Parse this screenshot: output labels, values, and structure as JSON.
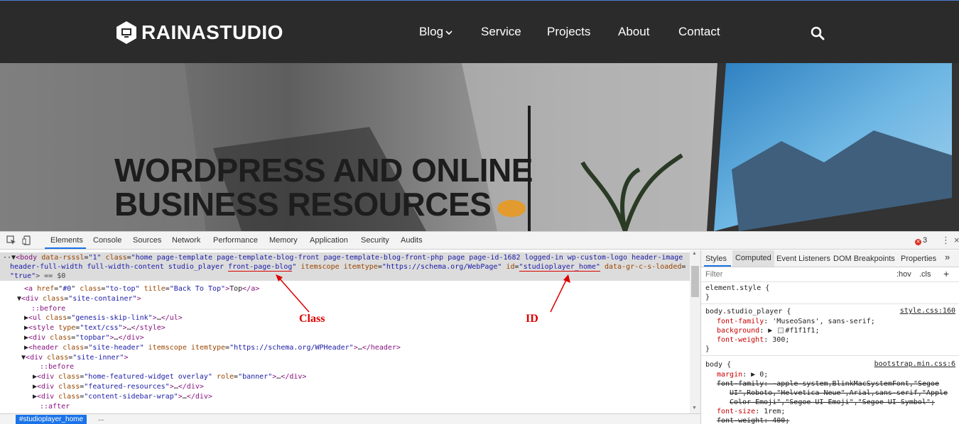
{
  "site": {
    "logo_text": "RAINASTUDIO",
    "nav": [
      "Blog",
      "Service",
      "Projects",
      "About",
      "Contact"
    ],
    "hero_line1": "WORDPRESS AND ONLINE",
    "hero_line2": "BUSINESS RESOURCES"
  },
  "devtools": {
    "tabs": [
      "Elements",
      "Console",
      "Sources",
      "Network",
      "Performance",
      "Memory",
      "Application",
      "Security",
      "Audits"
    ],
    "error_count": "3",
    "dom": {
      "l1a": "<body ",
      "l1_attr1": "data-rsssl",
      "l1_val1": "\"1\"",
      "l1_attr2": "class",
      "l1_val2a": "\"home page-template page-template-blog-front page-template-blog-front-php page page-id-1682 logged-in wp-custom-logo header-image",
      "l2_val2b": "header-full-width full-width-content studio_player ",
      "l2_val2c": "front-page-blog",
      "l2_val2d": "\"",
      "l2_attr3": "itemscope",
      "l2_attr4": "itemtype",
      "l2_val4": "\"https://schema.org/WebPage\"",
      "l2_attr5": "id",
      "l2_val5a": "\"",
      "l2_val5b": "studioplayer_home",
      "l2_val5c": "\"",
      "l2_attr6": "data-gr-c-s-loaded",
      "l3_val6": "\"true\"",
      "l3_tail": "> == $0",
      "rows": [
        {
          "indent": 34,
          "parts": [
            [
              "tag",
              "<a "
            ],
            [
              "attr",
              "href"
            ],
            [
              "plain",
              "=\""
            ],
            [
              "val",
              "#0"
            ],
            [
              "plain",
              "\" "
            ],
            [
              "attr",
              "class"
            ],
            [
              "plain",
              "="
            ],
            [
              "val",
              "\"to-top\""
            ],
            [
              "plain",
              " "
            ],
            [
              "attr",
              "title"
            ],
            [
              "plain",
              "="
            ],
            [
              "val",
              "\"Back To Top\""
            ],
            [
              "tag",
              ">"
            ],
            [
              "plain",
              "Top"
            ],
            [
              "tag",
              "</a>"
            ]
          ]
        },
        {
          "indent": 24,
          "parts": [
            [
              "plain",
              "▼"
            ],
            [
              "tag",
              "<div "
            ],
            [
              "attr",
              "class"
            ],
            [
              "plain",
              "="
            ],
            [
              "val",
              "\"site-container\""
            ],
            [
              "tag",
              ">"
            ]
          ]
        },
        {
          "indent": 44,
          "parts": [
            [
              "pseudo",
              "::before"
            ]
          ]
        },
        {
          "indent": 34,
          "parts": [
            [
              "plain",
              "▶"
            ],
            [
              "tag",
              "<ul "
            ],
            [
              "attr",
              "class"
            ],
            [
              "plain",
              "="
            ],
            [
              "val",
              "\"genesis-skip-link\""
            ],
            [
              "tag",
              ">"
            ],
            [
              "plain",
              "…"
            ],
            [
              "tag",
              "</ul>"
            ]
          ]
        },
        {
          "indent": 34,
          "parts": [
            [
              "plain",
              "▶"
            ],
            [
              "tag",
              "<style "
            ],
            [
              "attr",
              "type"
            ],
            [
              "plain",
              "="
            ],
            [
              "val",
              "\"text/css\""
            ],
            [
              "tag",
              ">"
            ],
            [
              "plain",
              "…"
            ],
            [
              "tag",
              "</style>"
            ]
          ]
        },
        {
          "indent": 34,
          "parts": [
            [
              "plain",
              "▶"
            ],
            [
              "tag",
              "<div "
            ],
            [
              "attr",
              "class"
            ],
            [
              "plain",
              "="
            ],
            [
              "val",
              "\"topbar\""
            ],
            [
              "tag",
              ">"
            ],
            [
              "plain",
              "…"
            ],
            [
              "tag",
              "</div>"
            ]
          ]
        },
        {
          "indent": 34,
          "parts": [
            [
              "plain",
              "▶"
            ],
            [
              "tag",
              "<header "
            ],
            [
              "attr",
              "class"
            ],
            [
              "plain",
              "="
            ],
            [
              "val",
              "\"site-header\""
            ],
            [
              "plain",
              " "
            ],
            [
              "attr",
              "itemscope"
            ],
            [
              "plain",
              " "
            ],
            [
              "attr",
              "itemtype"
            ],
            [
              "plain",
              "="
            ],
            [
              "val",
              "\"https://schema.org/WPHeader\""
            ],
            [
              "tag",
              ">"
            ],
            [
              "plain",
              "…"
            ],
            [
              "tag",
              "</header>"
            ]
          ]
        },
        {
          "indent": 24,
          "parts": [
            [
              "plain",
              " ▼"
            ],
            [
              "tag",
              "<div "
            ],
            [
              "attr",
              "class"
            ],
            [
              "plain",
              "="
            ],
            [
              "val",
              "\"site-inner\""
            ],
            [
              "tag",
              ">"
            ]
          ]
        },
        {
          "indent": 56,
          "parts": [
            [
              "pseudo",
              "::before"
            ]
          ]
        },
        {
          "indent": 46,
          "parts": [
            [
              "plain",
              "▶"
            ],
            [
              "tag",
              "<div "
            ],
            [
              "attr",
              "class"
            ],
            [
              "plain",
              "="
            ],
            [
              "val",
              "\"home-featured-widget overlay\""
            ],
            [
              "plain",
              " "
            ],
            [
              "attr",
              "role"
            ],
            [
              "plain",
              "="
            ],
            [
              "val",
              "\"banner\""
            ],
            [
              "tag",
              ">"
            ],
            [
              "plain",
              "…"
            ],
            [
              "tag",
              "</div>"
            ]
          ]
        },
        {
          "indent": 46,
          "parts": [
            [
              "plain",
              "▶"
            ],
            [
              "tag",
              "<div "
            ],
            [
              "attr",
              "class"
            ],
            [
              "plain",
              "="
            ],
            [
              "val",
              "\"featured-resources\""
            ],
            [
              "tag",
              ">"
            ],
            [
              "plain",
              "…"
            ],
            [
              "tag",
              "</div>"
            ]
          ]
        },
        {
          "indent": 46,
          "parts": [
            [
              "plain",
              "▶"
            ],
            [
              "tag",
              "<div "
            ],
            [
              "attr",
              "class"
            ],
            [
              "plain",
              "="
            ],
            [
              "val",
              "\"content-sidebar-wrap\""
            ],
            [
              "tag",
              ">"
            ],
            [
              "plain",
              "…"
            ],
            [
              "tag",
              "</div>"
            ]
          ]
        },
        {
          "indent": 56,
          "parts": [
            [
              "pseudo",
              "::after"
            ]
          ]
        }
      ]
    },
    "annotations": {
      "class_label": "Class",
      "id_label": "ID"
    },
    "breadcrumb": "#studioplayer_home",
    "breadcrumb_more": "...",
    "styles_tabs": [
      "Styles",
      "Computed",
      "Event Listeners",
      "DOM Breakpoints",
      "Properties"
    ],
    "filter_placeholder": "Filter",
    "filter_hov": ":hov",
    "filter_cls": ".cls",
    "rules": {
      "r1_selector": "element.style {",
      "close": "}",
      "r2_selector": "body.studio_player {",
      "r2_source": "style.css:160",
      "r2_props": [
        [
          "font-family",
          "'MuseoSans', sans-serif;"
        ],
        [
          "background",
          "#f1f1f1;"
        ],
        [
          "font-weight",
          "300;"
        ]
      ],
      "r3_selector": "body {",
      "r3_source": "bootstrap.min.css:6",
      "r3_margin": [
        "margin",
        "0;"
      ],
      "r3_ff_1": "font-family: -apple-system,BlinkMacSystemFont,\"Segoe",
      "r3_ff_2": "UI\",Roboto,\"Helvetica Neue\",Arial,sans-serif,\"Apple",
      "r3_ff_3": "Color Emoji\",\"Segoe UI Emoji\",\"Segoe UI Symbol\";",
      "r3_fs": [
        "font-size",
        "1rem;"
      ],
      "r3_fw": "font-weight: 400;"
    }
  }
}
